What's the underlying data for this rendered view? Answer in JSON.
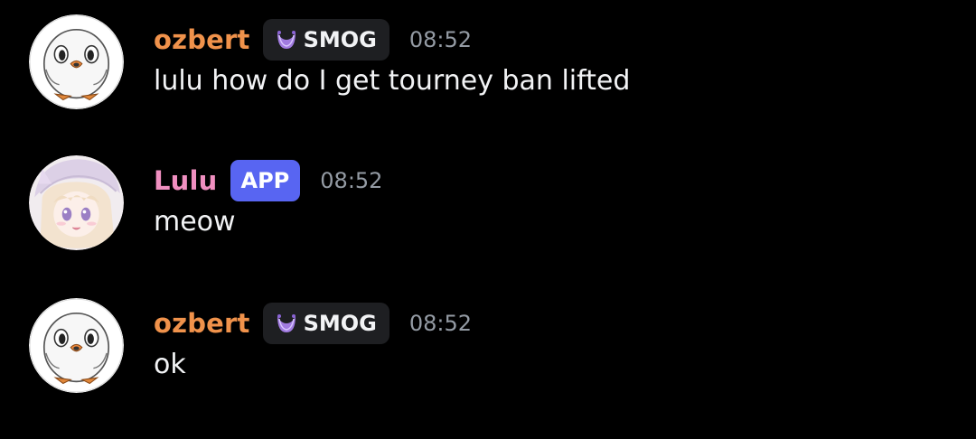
{
  "colors": {
    "ozbert_name": "#f0924b",
    "lulu_name": "#f08fc0",
    "app_tag_bg": "#5865f2",
    "guild_tag_bg": "#1e1f22",
    "timestamp": "#949ba4",
    "background": "#000000"
  },
  "messages": [
    {
      "author": "ozbert",
      "tag_icon": "purple-crescent-icon",
      "tag_label": "SMOG",
      "timestamp": "08:52",
      "content": "lulu how do I get tourney ban lifted"
    },
    {
      "author": "Lulu",
      "tag_label": "APP",
      "timestamp": "08:52",
      "content": "meow"
    },
    {
      "author": "ozbert",
      "tag_icon": "purple-crescent-icon",
      "tag_label": "SMOG",
      "timestamp": "08:52",
      "content": "ok"
    }
  ]
}
